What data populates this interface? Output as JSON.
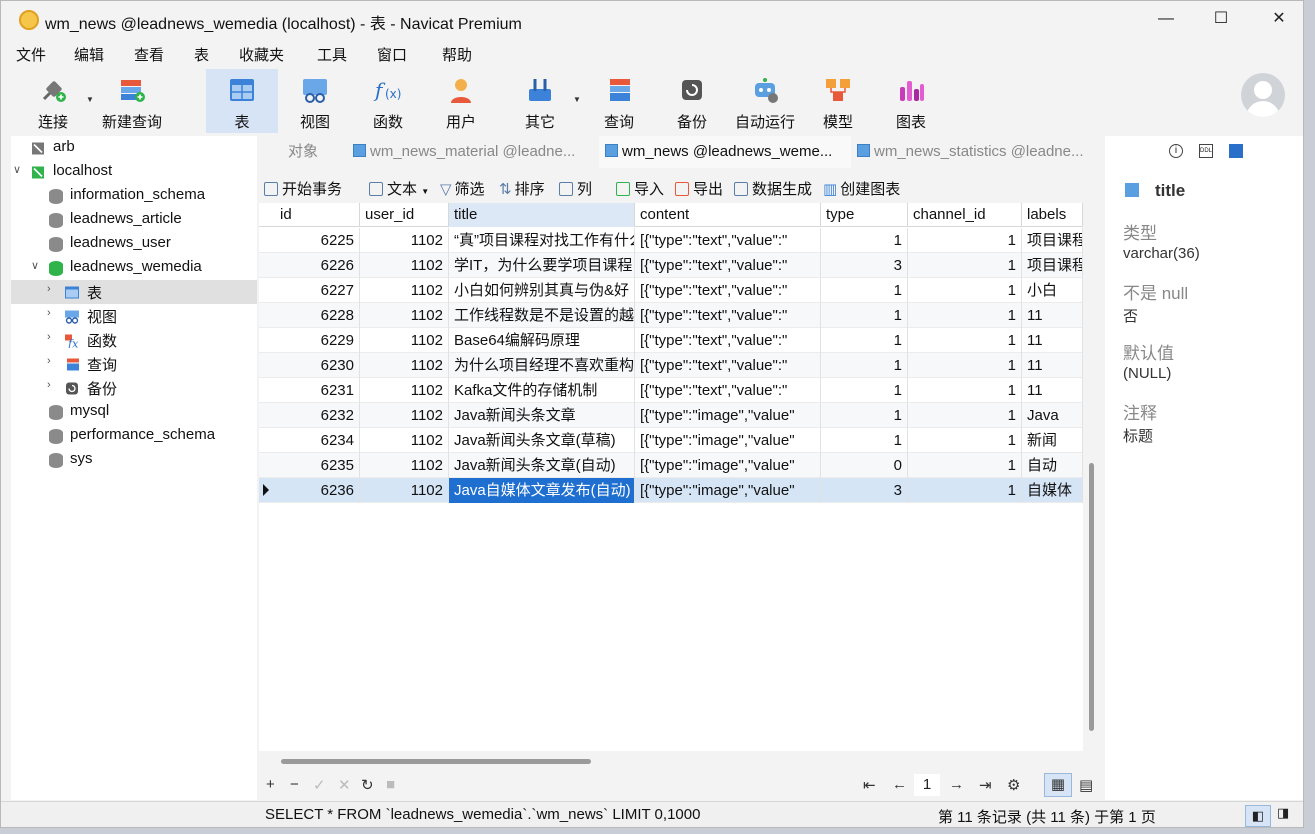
{
  "window": {
    "title": "wm_news @leadnews_wemedia (localhost) - 表 - Navicat Premium"
  },
  "menu": [
    "文件",
    "编辑",
    "查看",
    "表",
    "收藏夹",
    "工具",
    "窗口",
    "帮助"
  ],
  "toolbar": {
    "connect": "连接",
    "new_query": "新建查询",
    "table": "表",
    "view": "视图",
    "function": "函数",
    "user": "用户",
    "other": "其它",
    "query": "查询",
    "backup": "备份",
    "automation": "自动运行",
    "model": "模型",
    "chart": "图表"
  },
  "sidebar": {
    "items": [
      {
        "label": "arb"
      },
      {
        "label": "localhost"
      },
      {
        "label": "information_schema"
      },
      {
        "label": "leadnews_article"
      },
      {
        "label": "leadnews_user"
      },
      {
        "label": "leadnews_wemedia"
      },
      {
        "label": "表"
      },
      {
        "label": "视图"
      },
      {
        "label": "函数"
      },
      {
        "label": "查询"
      },
      {
        "label": "备份"
      },
      {
        "label": "mysql"
      },
      {
        "label": "performance_schema"
      },
      {
        "label": "sys"
      }
    ]
  },
  "tabs": [
    {
      "label": "对象"
    },
    {
      "label": "wm_news_material @leadne..."
    },
    {
      "label": "wm_news @leadnews_weme..."
    },
    {
      "label": "wm_news_statistics @leadne..."
    }
  ],
  "objtools": {
    "begin_tx": "开始事务",
    "text": "文本",
    "filter": "筛选",
    "sort": "排序",
    "columns": "列",
    "import": "导入",
    "export": "导出",
    "datagen": "数据生成",
    "create_chart": "创建图表"
  },
  "grid": {
    "columns": [
      "id",
      "user_id",
      "title",
      "content",
      "type",
      "channel_id",
      "labels"
    ],
    "rows": [
      [
        "6225",
        "1102",
        "“真”项目课程对找工作有什么",
        "[{\"type\":\"text\",\"value\":\"",
        "1",
        "1",
        "项目课程"
      ],
      [
        "6226",
        "1102",
        "学IT，为什么要学项目课程",
        "[{\"type\":\"text\",\"value\":\"",
        "3",
        "1",
        "项目课程"
      ],
      [
        "6227",
        "1102",
        "小白如何辨别其真与伪&好",
        "[{\"type\":\"text\",\"value\":\"",
        "1",
        "1",
        "小白"
      ],
      [
        "6228",
        "1102",
        "工作线程数是不是设置的越",
        "[{\"type\":\"text\",\"value\":\"",
        "1",
        "1",
        "11"
      ],
      [
        "6229",
        "1102",
        "Base64编解码原理",
        "[{\"type\":\"text\",\"value\":\"",
        "1",
        "1",
        "11"
      ],
      [
        "6230",
        "1102",
        "为什么项目经理不喜欢重构",
        "[{\"type\":\"text\",\"value\":\"",
        "1",
        "1",
        "11"
      ],
      [
        "6231",
        "1102",
        "Kafka文件的存储机制",
        "[{\"type\":\"text\",\"value\":\"",
        "1",
        "1",
        "11"
      ],
      [
        "6232",
        "1102",
        "Java新闻头条文章",
        "[{\"type\":\"image\",\"value\"",
        "1",
        "1",
        "Java"
      ],
      [
        "6234",
        "1102",
        "Java新闻头条文章(草稿)",
        "[{\"type\":\"image\",\"value\"",
        "1",
        "1",
        "新闻"
      ],
      [
        "6235",
        "1102",
        "Java新闻头条文章(自动)",
        "[{\"type\":\"image\",\"value\"",
        "0",
        "1",
        "自动"
      ],
      [
        "6236",
        "1102",
        "Java自媒体文章发布(自动)",
        "[{\"type\":\"image\",\"value\"",
        "3",
        "1",
        "自媒体"
      ]
    ]
  },
  "footer": {
    "add": "+",
    "remove": "−",
    "apply": "✓",
    "cancel": "✕",
    "refresh": "↻",
    "stop": "■",
    "first": "⇤",
    "prev": "←",
    "page": "1",
    "next": "→",
    "last": "⇥"
  },
  "status": {
    "sql": "SELECT * FROM `leadnews_wemedia`.`wm_news` LIMIT 0,1000",
    "records": "第 11 条记录  (共 11 条) 于第 1 页"
  },
  "panel": {
    "field_name": "title",
    "type_label": "类型",
    "type_value": "varchar(36)",
    "notnull_label": "不是 null",
    "notnull_value": "否",
    "default_label": "默认值",
    "default_value": "(NULL)",
    "comment_label": "注释",
    "comment_value": "标题"
  }
}
